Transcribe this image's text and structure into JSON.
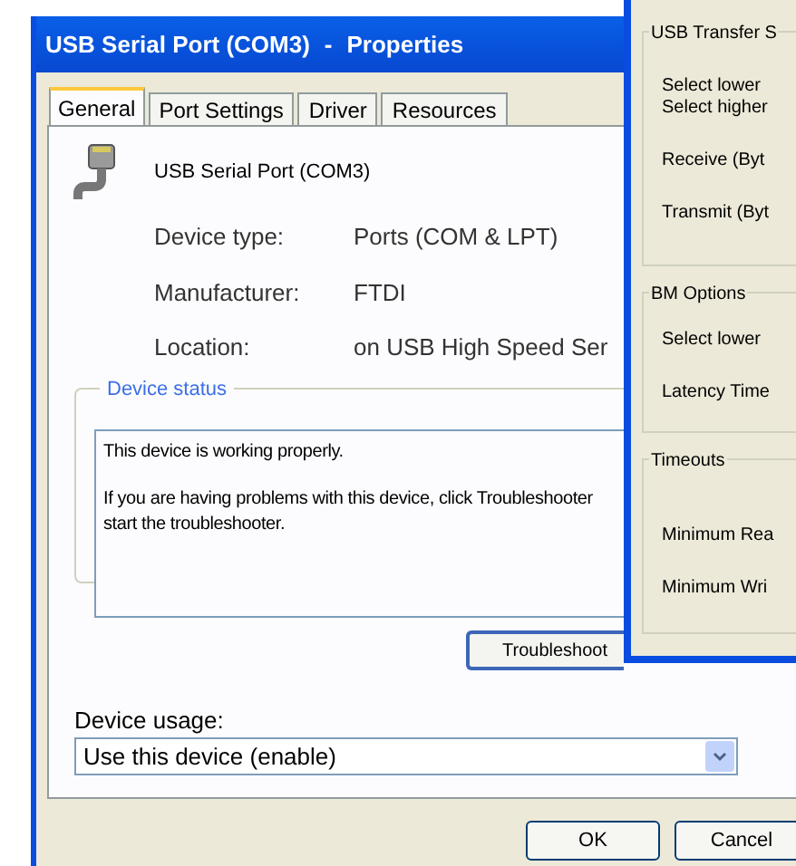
{
  "dialog": {
    "title": "USB Serial Port (COM3)",
    "separator": "-",
    "title_suffix": "Properties",
    "tabs": [
      {
        "label": "General",
        "selected": true
      },
      {
        "label": "Port Settings",
        "selected": false
      },
      {
        "label": "Driver",
        "selected": false
      },
      {
        "label": "Resources",
        "selected": false
      }
    ],
    "device_name": "USB Serial Port (COM3)",
    "properties": [
      {
        "label": "Device type:",
        "value": "Ports (COM & LPT)"
      },
      {
        "label": "Manufacturer:",
        "value": "FTDI"
      },
      {
        "label": "Location:",
        "value": "on USB High Speed Ser"
      }
    ],
    "device_status": {
      "title": "Device status",
      "lines": [
        "This device is working properly.",
        "If you are having problems with this device, click Troubleshooter",
        "start the troubleshooter."
      ],
      "button": "Troubleshoot"
    },
    "device_usage": {
      "label": "Device usage:",
      "value": "Use this device (enable)"
    },
    "buttons": [
      "OK",
      "Cancel"
    ]
  },
  "back_window": {
    "groups": [
      {
        "title": "USB Transfer S",
        "items": [
          "Select lower",
          "Select higher",
          "Receive (Byt",
          "Transmit (Byt"
        ]
      },
      {
        "title": "BM Options",
        "items": [
          "Select lower",
          "Latency Time"
        ]
      },
      {
        "title": "Timeouts",
        "items": [
          "Minimum Rea",
          "Minimum Wri"
        ]
      }
    ]
  }
}
